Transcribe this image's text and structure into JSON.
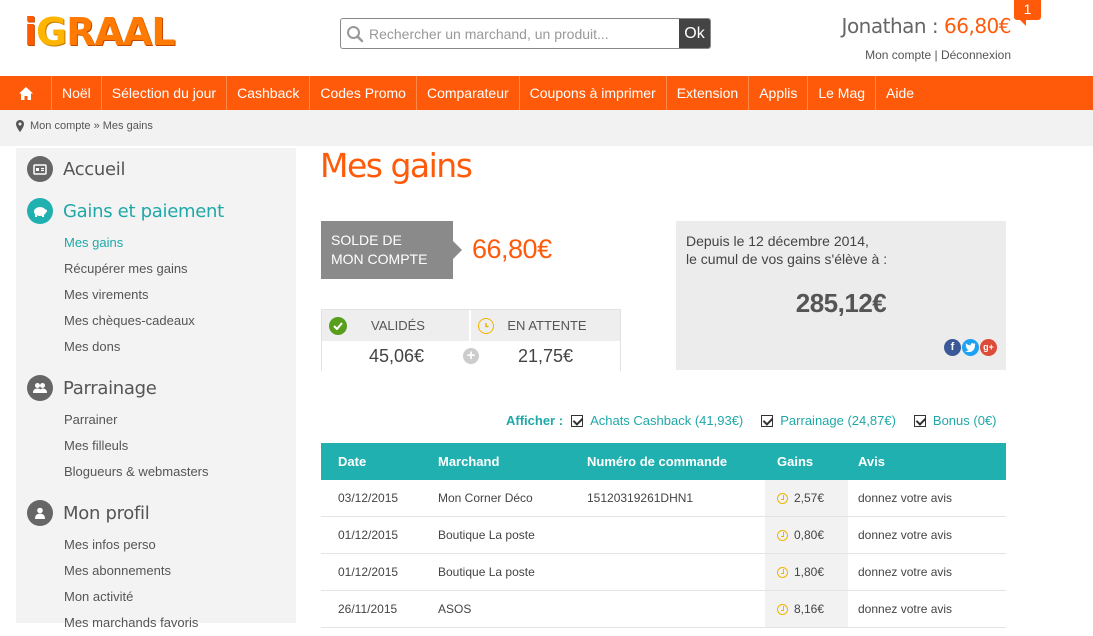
{
  "header": {
    "logo_letters": [
      "i",
      "G",
      "R",
      "A",
      "A",
      "L"
    ],
    "search_placeholder": "Rechercher un marchand, un produit...",
    "search_button": "Ok",
    "user_name": "Jonathan : ",
    "user_balance": "66,80€",
    "account_link": "Mon compte",
    "separator": " | ",
    "logout_link": "Déconnexion",
    "notification_count": "1"
  },
  "nav": {
    "items": [
      "Noël",
      "Sélection du jour",
      "Cashback",
      "Codes Promo",
      "Comparateur",
      "Coupons à imprimer",
      "Extension",
      "Applis",
      "Le Mag",
      "Aide"
    ]
  },
  "breadcrumb": {
    "text": "Mon compte » Mes gains"
  },
  "sidebar": {
    "accueil": "Accueil",
    "gains": {
      "title": "Gains et paiement",
      "items": [
        "Mes gains",
        "Récupérer mes gains",
        "Mes virements",
        "Mes chèques-cadeaux",
        "Mes dons"
      ]
    },
    "parrainage": {
      "title": "Parrainage",
      "items": [
        "Parrainer",
        "Mes filleuls",
        "Blogueurs & webmasters"
      ]
    },
    "profil": {
      "title": "Mon profil",
      "items": [
        "Mes infos perso",
        "Mes abonnements",
        "Mon activité",
        "Mes marchands favoris"
      ]
    }
  },
  "main": {
    "title": "Mes gains",
    "solde_label_1": "SOLDE DE",
    "solde_label_2": "MON COMPTE",
    "solde_amount": "66,80€",
    "validated_label": "VALIDÉS",
    "validated_amount": "45,06€",
    "pending_label": "EN ATTENTE",
    "pending_amount": "21,75€",
    "cumul_line1": "Depuis le 12 décembre 2014,",
    "cumul_line2": "le cumul de vos gains s'élève à :",
    "cumul_amount": "285,12€",
    "filters_label": "Afficher :",
    "filters": [
      "Achats Cashback (41,93€)",
      "Parrainage (24,87€)",
      "Bonus (0€)"
    ]
  },
  "table": {
    "headers": [
      "Date",
      "Marchand",
      "Numéro de commande",
      "Gains",
      "Avis"
    ],
    "rows": [
      {
        "date": "03/12/2015",
        "merchant": "Mon Corner Déco",
        "order": "15120319261DHN1",
        "gains": "2,57€",
        "avis": "donnez votre avis"
      },
      {
        "date": "01/12/2015",
        "merchant": "Boutique La poste",
        "order": "",
        "gains": "0,80€",
        "avis": "donnez votre avis"
      },
      {
        "date": "01/12/2015",
        "merchant": "Boutique La poste",
        "order": "",
        "gains": "1,80€",
        "avis": "donnez votre avis"
      },
      {
        "date": "26/11/2015",
        "merchant": "ASOS",
        "order": "",
        "gains": "8,16€",
        "avis": "donnez votre avis"
      }
    ]
  },
  "colors": {
    "brand_orange": "#ff5a0a",
    "teal": "#20b0b0",
    "pending_yellow": "#f0b400",
    "validated_green": "#5a9e1e"
  }
}
